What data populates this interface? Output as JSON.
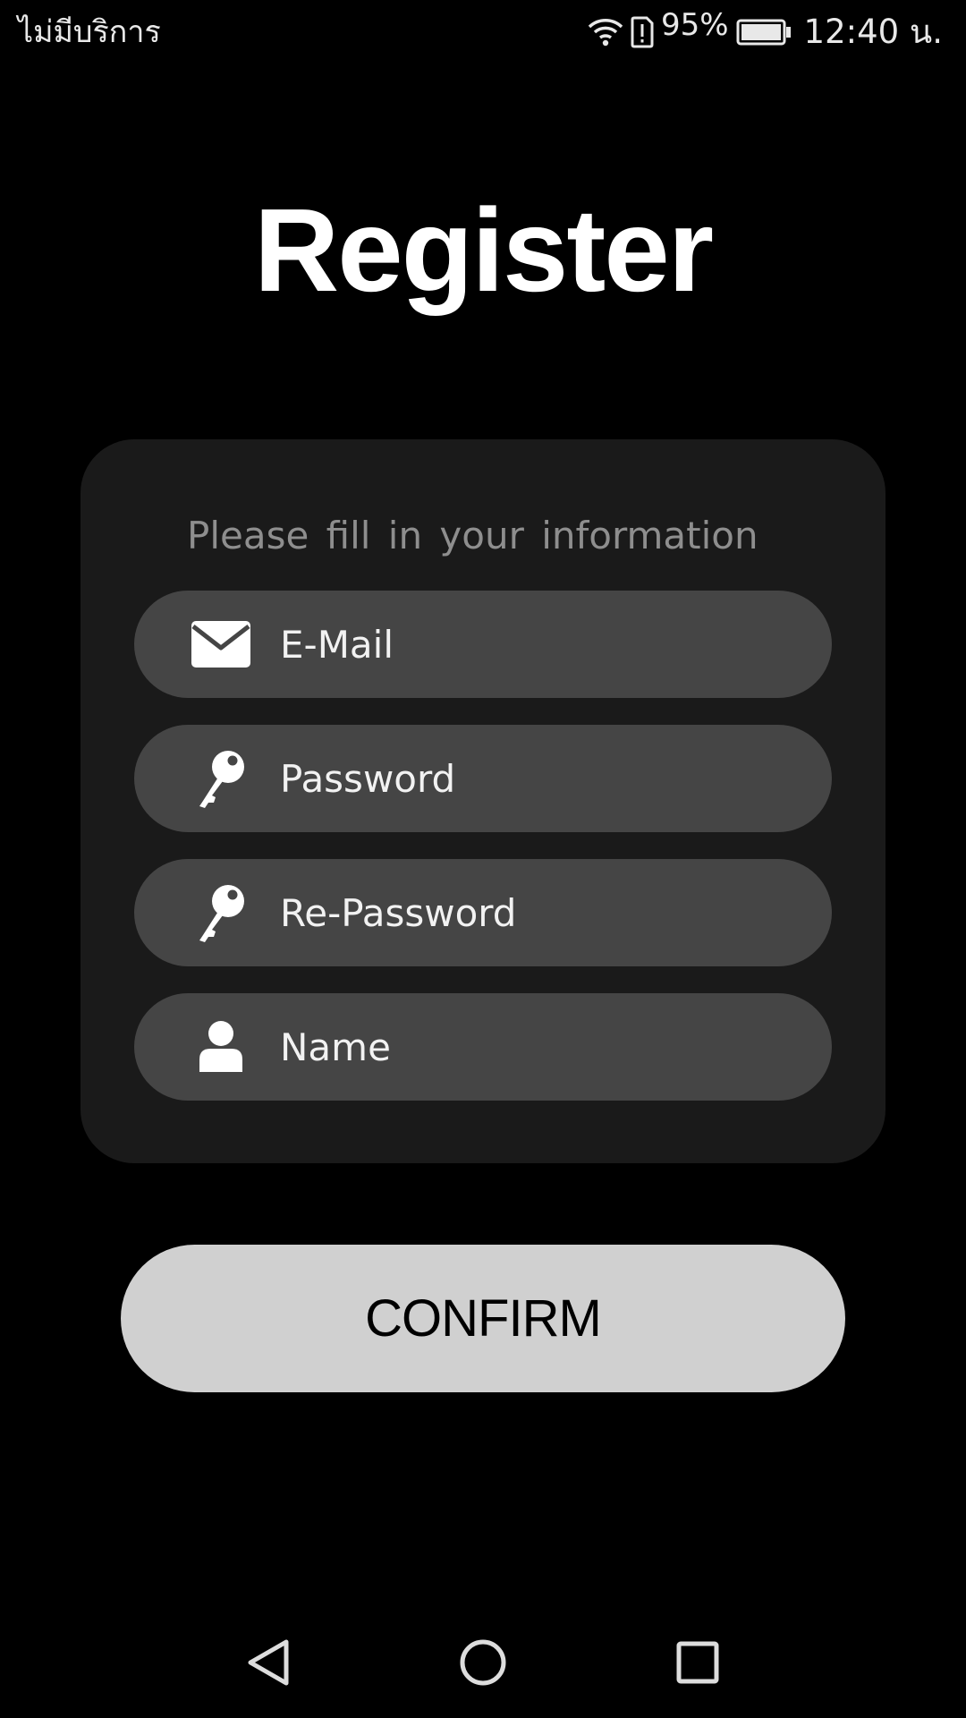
{
  "status_bar": {
    "carrier": "ไม่มีบริการ",
    "battery_percent": "95%",
    "time": "12:40 น.",
    "icons": [
      "wifi-icon",
      "sim-alert-icon",
      "battery-icon"
    ]
  },
  "title": "Register",
  "form": {
    "hint": "Please fill in your information",
    "fields": [
      {
        "placeholder": "E-Mail",
        "value": "",
        "icon": "mail-icon"
      },
      {
        "placeholder": "Password",
        "value": "",
        "icon": "key-icon"
      },
      {
        "placeholder": "Re-Password",
        "value": "",
        "icon": "key-icon"
      },
      {
        "placeholder": "Name",
        "value": "",
        "icon": "person-icon"
      }
    ]
  },
  "confirm_label": "CONFIRM",
  "nav_bar": {
    "icons": [
      "back-icon",
      "home-icon",
      "recents-icon"
    ]
  },
  "colors": {
    "background": "#000000",
    "card": "#1a1a1a",
    "field": "#454545",
    "button": "#d0d0d0",
    "hint_text": "#8e8e8e"
  }
}
